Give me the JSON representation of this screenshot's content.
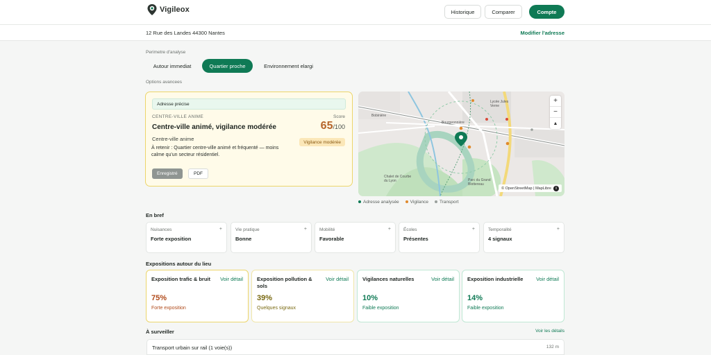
{
  "header": {
    "logo_text": "Vigileox",
    "nav": [
      "Historique",
      "Comparer",
      "Compte"
    ]
  },
  "address": {
    "text": "12 Rue des Landes 44300 Nantes",
    "modify_label": "Modifier l'adresse"
  },
  "perimeter": {
    "label": "Perimetre d'analyse",
    "options": [
      "Autour immediat",
      "Quartier proche",
      "Environnement elargi"
    ],
    "selected": "Quartier proche"
  },
  "advanced_label": "Options avancees",
  "score_card": {
    "badge": "Adresse précise",
    "category": "CENTRE-VILLE ANIME",
    "score_label": "Score",
    "title": "Centre-ville animé, vigilance modérée",
    "score": "65",
    "score_max": "/100",
    "subtitle": "Centre-ville anime",
    "vigilance_badge": "Vigilance modérée",
    "note": "À retenir : Quartier centre-ville animé et fréquenté — moins calme qu'un secteur résidentiel.",
    "saved_label": "Enregistré",
    "pdf_label": "PDF"
  },
  "map": {
    "zoom_in": "+",
    "zoom_out": "−",
    "reset": "▲",
    "attribution": "© OpenStreetMap | MapLibre",
    "info": "i",
    "labels": [
      "Bobinière",
      "Bourgeonnière",
      "Chalet de Courbe du Lyon",
      "Parc du Grand Blottereau",
      "Lycée Jules Verne"
    ],
    "legend": [
      {
        "label": "Adresse analysée",
        "color": "#0f7a55"
      },
      {
        "label": "Vigilance",
        "color": "#e08a2c"
      },
      {
        "label": "Transport",
        "color": "#9aa09c"
      }
    ]
  },
  "brief": {
    "title": "En bref",
    "items": [
      {
        "label": "Nuisances",
        "value": "Forte exposition"
      },
      {
        "label": "Vie pratique",
        "value": "Bonne"
      },
      {
        "label": "Mobilité",
        "value": "Favorable"
      },
      {
        "label": "Écoles",
        "value": "Présentes"
      },
      {
        "label": "Temporalité",
        "value": "4 signaux"
      }
    ],
    "plus": "+"
  },
  "expositions": {
    "title": "Expositions autour du lieu",
    "link_label": "Voir détail",
    "items": [
      {
        "title": "Exposition trafic & bruit",
        "pct": "75%",
        "status": "Forte exposition",
        "color": "#b04a1a",
        "border": "#ecd56a"
      },
      {
        "title": "Exposition pollution & sols",
        "pct": "39%",
        "status": "Quelques signaux",
        "color": "#7a6a12",
        "border": "#f0e6a8"
      },
      {
        "title": "Vigilances naturelles",
        "pct": "10%",
        "status": "Faible exposition",
        "color": "#0f7a55",
        "border": "#bfe8d4"
      },
      {
        "title": "Exposition industrielle",
        "pct": "14%",
        "status": "Faible exposition",
        "color": "#0f7a55",
        "border": "#bfe8d4"
      }
    ]
  },
  "watch": {
    "title": "À surveiller",
    "link_label": "Voir les détails",
    "first_item": "Transport urbain sur rail (1 voie(s))",
    "first_distance": "132 m"
  }
}
